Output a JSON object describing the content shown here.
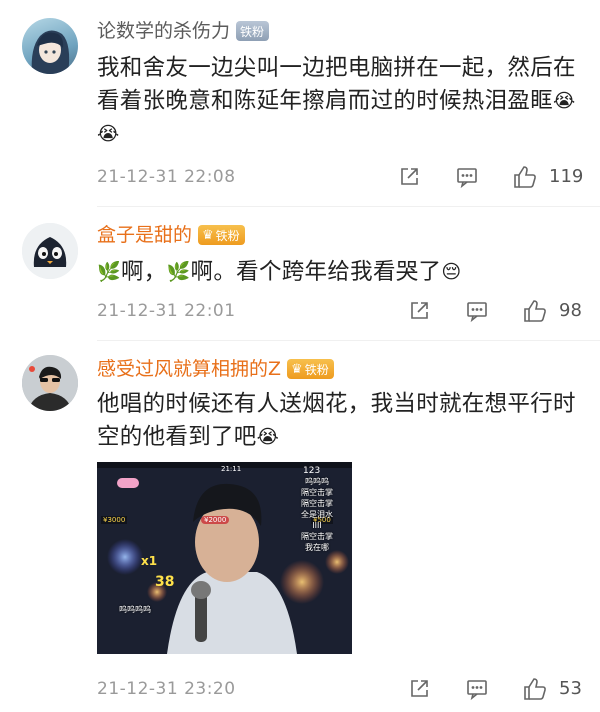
{
  "comments": [
    {
      "username": "论数学的杀伤力",
      "badge": "铁粉",
      "text": "我和舍友一边尖叫一边把电脑拼在一起，然后在看着张晚意和陈延年擦肩而过的时候热泪盈眶",
      "emojis": [
        "crying-emoji",
        "crying-emoji"
      ],
      "time": "21-12-31 22:08",
      "likes": "119"
    },
    {
      "username": "盒子是甜的",
      "badge": "铁粉",
      "text_parts": [
        "啊，",
        "啊。看个跨年给我看哭了"
      ],
      "emojis": [
        "leaf-emoji",
        "leaf-emoji",
        "sad-face-emoji"
      ],
      "time": "21-12-31 22:01",
      "likes": "98"
    },
    {
      "username": "感受过风就算相拥的Z",
      "badge": "铁粉",
      "text": "他唱的时候还有人送烟花，我当时就在想平行时空的他看到了吧",
      "emojis": [
        "crying-emoji"
      ],
      "time": "21-12-31 23:20",
      "likes": "53"
    }
  ],
  "video_overlay": {
    "clock": "21:11",
    "top_count": "123",
    "barrage": [
      "呜呜呜",
      "隔空击掌",
      "隔空击掌",
      "全是泪水",
      "IIII",
      "隔空击掌",
      "我在哪",
      "呜呜呜呜"
    ],
    "gift_prices": [
      "¥3000",
      "¥2000",
      "¥500"
    ],
    "multiplier_a": "x1",
    "multiplier_b": "38"
  },
  "colors": {
    "username_orange": "#e8701a",
    "meta_gray": "#9a9a9a"
  }
}
